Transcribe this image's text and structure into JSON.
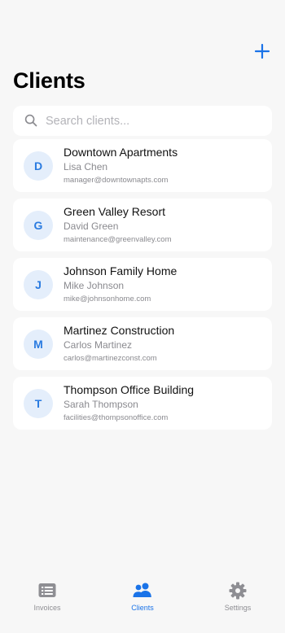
{
  "header": {
    "title": "Clients",
    "add_icon": "plus-icon"
  },
  "search": {
    "placeholder": "Search clients...",
    "value": "",
    "icon": "search-icon"
  },
  "clients": [
    {
      "initial": "D",
      "name": "Downtown Apartments",
      "contact": "Lisa Chen",
      "email": "manager@downtownapts.com"
    },
    {
      "initial": "G",
      "name": "Green Valley Resort",
      "contact": "David Green",
      "email": "maintenance@greenvalley.com"
    },
    {
      "initial": "J",
      "name": "Johnson Family Home",
      "contact": "Mike Johnson",
      "email": "mike@johnsonhome.com"
    },
    {
      "initial": "M",
      "name": "Martinez Construction",
      "contact": "Carlos Martinez",
      "email": "carlos@martinezconst.com"
    },
    {
      "initial": "T",
      "name": "Thompson Office Building",
      "contact": "Sarah Thompson",
      "email": "facilities@thompsonoffice.com"
    }
  ],
  "tabbar": {
    "items": [
      {
        "label": "Invoices",
        "icon": "invoice-icon",
        "active": false
      },
      {
        "label": "Clients",
        "icon": "people-icon",
        "active": true
      },
      {
        "label": "Settings",
        "icon": "gear-icon",
        "active": false
      }
    ]
  },
  "colors": {
    "accent": "#1a73e8",
    "avatar_bg": "#e4eefb",
    "avatar_text": "#2a7be0",
    "inactive_tab": "#8e8e93",
    "background": "#f7f7f7"
  }
}
